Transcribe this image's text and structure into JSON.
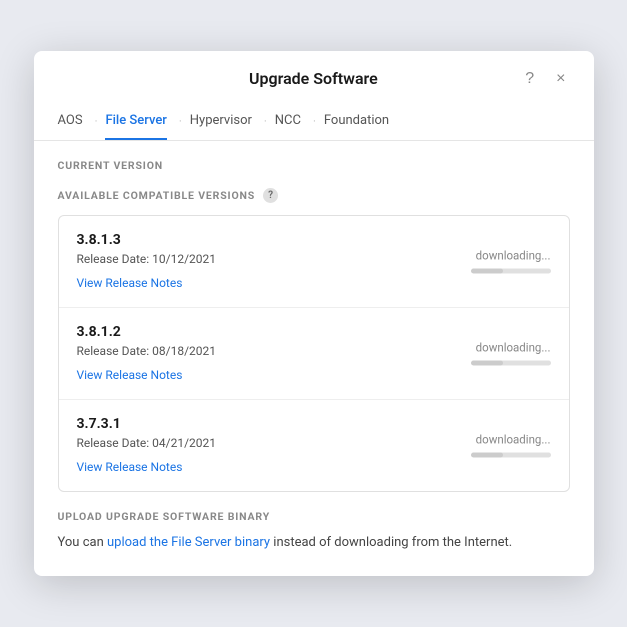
{
  "modal": {
    "title": "Upgrade Software",
    "help_button": "?",
    "close_button": "×"
  },
  "tabs": [
    {
      "label": "AOS",
      "active": false
    },
    {
      "label": "File Server",
      "active": true
    },
    {
      "label": "Hypervisor",
      "active": false
    },
    {
      "label": "NCC",
      "active": false
    },
    {
      "label": "Foundation",
      "active": false
    }
  ],
  "sections": {
    "current_version_label": "CURRENT VERSION",
    "available_label": "AVAILABLE COMPATIBLE VERSIONS",
    "help_icon": "?"
  },
  "versions": [
    {
      "number": "3.8.1.3",
      "date": "Release Date: 10/12/2021",
      "release_notes": "View Release Notes",
      "download_status": "downloading...",
      "progress": 40
    },
    {
      "number": "3.8.1.2",
      "date": "Release Date: 08/18/2021",
      "release_notes": "View Release Notes",
      "download_status": "downloading...",
      "progress": 40
    },
    {
      "number": "3.7.3.1",
      "date": "Release Date: 04/21/2021",
      "release_notes": "View Release Notes",
      "download_status": "downloading...",
      "progress": 40
    }
  ],
  "upload_section": {
    "label": "UPLOAD UPGRADE SOFTWARE BINARY",
    "text_before": "You can ",
    "link_text": "upload the File Server binary",
    "text_after": " instead of downloading from the Internet."
  }
}
